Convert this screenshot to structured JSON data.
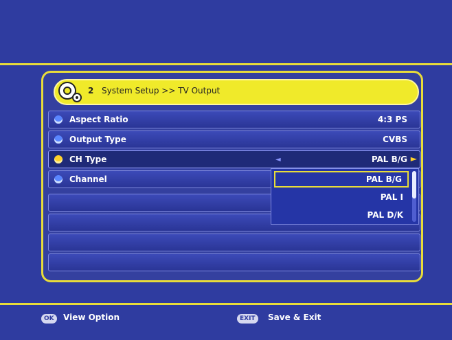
{
  "header": {
    "step_number": "2",
    "breadcrumb": "System Setup >> TV Output"
  },
  "rows": [
    {
      "label": "Aspect Ratio",
      "value": "4:3 PS"
    },
    {
      "label": "Output Type",
      "value": "CVBS"
    },
    {
      "label": "CH Type",
      "value": "PAL B/G"
    },
    {
      "label": "Channel",
      "value": ""
    }
  ],
  "dropdown": {
    "options": [
      "PAL B/G",
      "PAL I",
      "PAL D/K"
    ],
    "selected": "PAL B/G"
  },
  "footer": {
    "ok_key": "OK",
    "ok_label": "View Option",
    "exit_key": "EXIT",
    "exit_label": "Save & Exit"
  },
  "colors": {
    "background": "#2f3ca0",
    "accent_yellow": "#e8dc3a",
    "title_bar": "#f0ea2a"
  }
}
